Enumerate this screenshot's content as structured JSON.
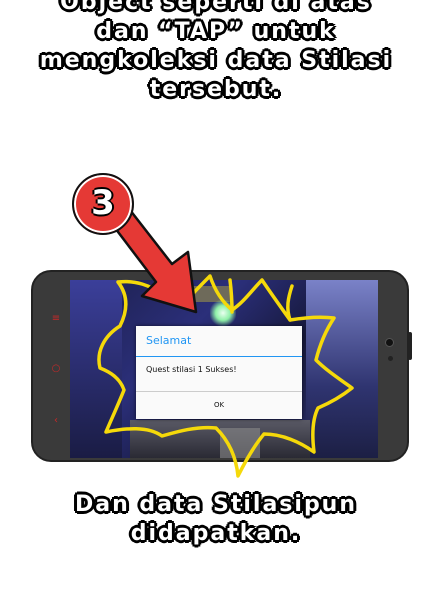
{
  "top_caption": {
    "lines": [
      "Object seperti di atas",
      "dan “TAP” untuk",
      "mengkoleksi data Stilasi",
      "tersebut."
    ]
  },
  "bottom_caption": {
    "lines": [
      "Dan data Stilasipun",
      "didapatkan."
    ]
  },
  "step_badge": "3",
  "dialog": {
    "title": "Selamat",
    "message": "Quest stilasi 1 Sukses!",
    "ok_label": "OK"
  },
  "colors": {
    "dialog_accent": "#2196f3",
    "badge_red": "#e53935",
    "arrow_red": "#e53935",
    "burst_yellow": "#f5d90a"
  },
  "icons": [
    "step-number-badge",
    "red-pointer-arrow-icon",
    "yellow-burst-icon",
    "front-camera-icon"
  ]
}
